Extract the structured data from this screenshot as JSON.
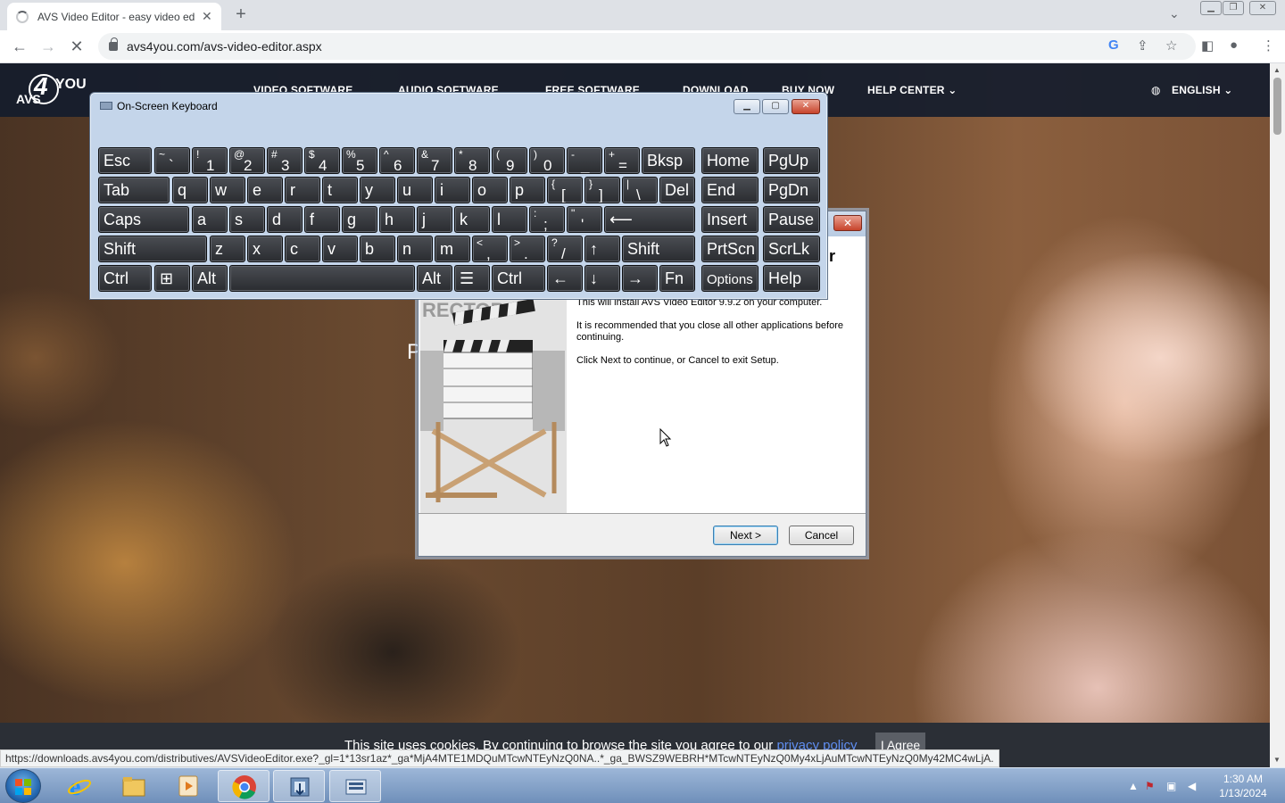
{
  "browser": {
    "tab_title": "AVS Video Editor - easy video ed",
    "tab_close": "✕",
    "new_tab": "+",
    "tab_search": "⌄",
    "url": "avs4you.com/avs-video-editor.aspx",
    "status_url": "https://downloads.avs4you.com/distributives/AVSVideoEditor.exe?_gl=1*13sr1az*_ga*MjA4MTE1MDQuMTcwNTEyNzQ0NA..*_ga_BWSZ9WEBRH*MTcwNTEyNzQ0My4xLjAuMTcwNTEyNzQ0My42MC4wLjA."
  },
  "site": {
    "logo": {
      "four": "4",
      "avs": "AVS",
      "you": "YOU"
    },
    "nav": [
      "VIDEO SOFTWARE",
      "AUDIO SOFTWARE",
      "FREE SOFTWARE",
      "DOWNLOAD",
      "BUY NOW",
      "HELP CENTER ⌄"
    ],
    "language": "ENGLISH ⌄",
    "hero_partial": "P",
    "cookie_text": "This site uses cookies. By continuing to browse the site you agree to our ",
    "cookie_link": "privacy policy",
    "cookie_button": "I Agree"
  },
  "installer": {
    "heading_partial": "r",
    "close": "✕",
    "body": [
      "This will install AVS Video Editor 9.9.2 on your computer.",
      "It is recommended that you close all other applications before continuing.",
      "Click Next to continue, or Cancel to exit Setup."
    ],
    "next_label": "Next >",
    "cancel_label": "Cancel",
    "clapboard_text": "RECTOR"
  },
  "osk": {
    "title": "On-Screen Keyboard",
    "rows": [
      [
        {
          "l": "Esc"
        },
        {
          "s": "~",
          "m": "`"
        },
        {
          "s": "!",
          "m": "1"
        },
        {
          "s": "@",
          "m": "2"
        },
        {
          "s": "#",
          "m": "3"
        },
        {
          "s": "$",
          "m": "4"
        },
        {
          "s": "%",
          "m": "5"
        },
        {
          "s": "^",
          "m": "6"
        },
        {
          "s": "&",
          "m": "7"
        },
        {
          "s": "*",
          "m": "8"
        },
        {
          "s": "(",
          "m": "9"
        },
        {
          "s": ")",
          "m": "0"
        },
        {
          "s": "-",
          "m": "_"
        },
        {
          "s": "+",
          "m": "="
        },
        {
          "l": "Bksp"
        },
        {
          "l": "Home"
        },
        {
          "l": "PgUp"
        }
      ],
      [
        {
          "l": "Tab"
        },
        {
          "l": "q"
        },
        {
          "l": "w"
        },
        {
          "l": "e"
        },
        {
          "l": "r"
        },
        {
          "l": "t"
        },
        {
          "l": "y"
        },
        {
          "l": "u"
        },
        {
          "l": "i"
        },
        {
          "l": "o"
        },
        {
          "l": "p"
        },
        {
          "s": "{",
          "m": "["
        },
        {
          "s": "}",
          "m": "]"
        },
        {
          "s": "|",
          "m": "\\"
        },
        {
          "l": "Del"
        },
        {
          "l": "End"
        },
        {
          "l": "PgDn"
        }
      ],
      [
        {
          "l": "Caps"
        },
        {
          "l": "a"
        },
        {
          "l": "s"
        },
        {
          "l": "d"
        },
        {
          "l": "f"
        },
        {
          "l": "g"
        },
        {
          "l": "h"
        },
        {
          "l": "j"
        },
        {
          "l": "k"
        },
        {
          "l": "l"
        },
        {
          "s": ":",
          "m": ";"
        },
        {
          "s": "\"",
          "m": "'"
        },
        {
          "l": "⟵"
        },
        {
          "l": "Insert"
        },
        {
          "l": "Pause"
        }
      ],
      [
        {
          "l": "Shift"
        },
        {
          "l": "z"
        },
        {
          "l": "x"
        },
        {
          "l": "c"
        },
        {
          "l": "v"
        },
        {
          "l": "b"
        },
        {
          "l": "n"
        },
        {
          "l": "m"
        },
        {
          "s": "<",
          "m": ","
        },
        {
          "s": ">",
          "m": "."
        },
        {
          "s": "?",
          "m": "/"
        },
        {
          "l": "↑"
        },
        {
          "l": "Shift"
        },
        {
          "l": "PrtScn"
        },
        {
          "l": "ScrLk"
        }
      ],
      [
        {
          "l": "Ctrl"
        },
        {
          "l": "⊞"
        },
        {
          "l": "Alt"
        },
        {
          "l": ""
        },
        {
          "l": "Alt"
        },
        {
          "l": "☰"
        },
        {
          "l": "Ctrl"
        },
        {
          "l": "←"
        },
        {
          "l": "↓"
        },
        {
          "l": "→"
        },
        {
          "l": "Fn"
        },
        {
          "l": "Options"
        },
        {
          "l": "Help"
        }
      ]
    ]
  },
  "taskbar": {
    "apps": [
      "internet-explorer",
      "file-explorer",
      "media-player",
      "chrome",
      "installer",
      "on-screen-keyboard"
    ],
    "clock_time": "1:30 AM",
    "clock_date": "1/13/2024"
  }
}
